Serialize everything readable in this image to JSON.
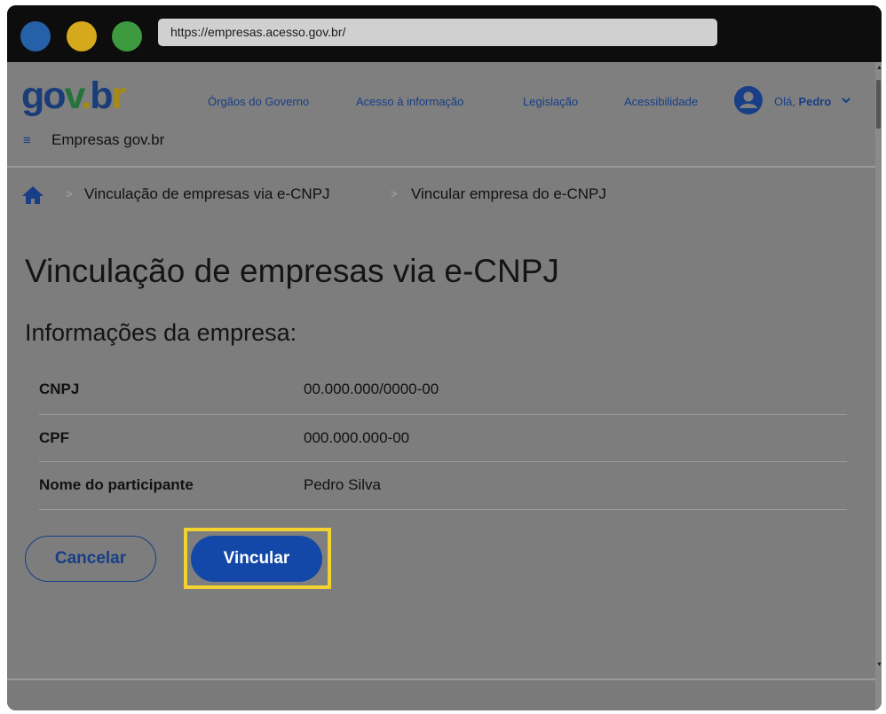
{
  "browser": {
    "url": "https://empresas.acesso.gov.br/"
  },
  "header": {
    "logo": "gov.br",
    "nav": [
      "Órgãos do Governo",
      "Acesso à informação",
      "Legislação",
      "Acessibilidade"
    ],
    "user_greeting": "Olá, ",
    "user_name": "Pedro",
    "site_name": "Empresas gov.br",
    "menu_icon": "hamburger-icon"
  },
  "breadcrumb": {
    "home_icon": "home-icon",
    "items": [
      "Vinculação de empresas via e-CNPJ",
      "Vincular empresa do e-CNPJ"
    ]
  },
  "main": {
    "title": "Vinculação de empresas via e-CNPJ",
    "section_title": "Informações da empresa:",
    "rows": [
      {
        "label": "CNPJ",
        "value": "00.000.000/0000-00"
      },
      {
        "label": "CPF",
        "value": "000.000.000-00"
      },
      {
        "label": "Nome do participante",
        "value": "Pedro Silva"
      }
    ]
  },
  "actions": {
    "cancel_label": "Cancelar",
    "submit_label": "Vincular",
    "highlight_color": "#f2d230",
    "primary_color": "#1348a8"
  }
}
